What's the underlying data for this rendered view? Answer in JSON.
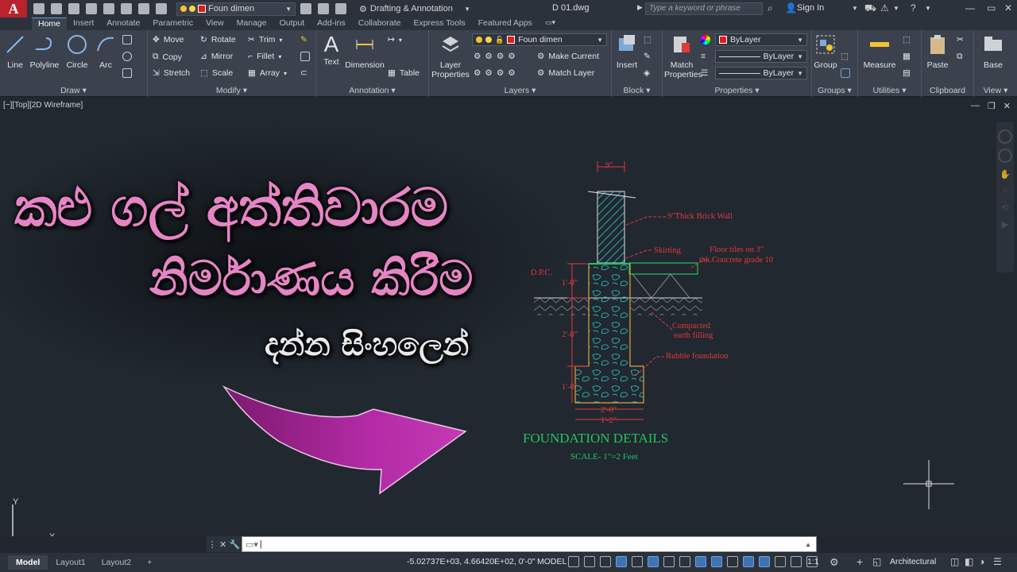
{
  "titlebar": {
    "app_logo": "A",
    "layer_name": "Foun  dimen",
    "workspace": "Drafting & Annotation",
    "document": "D  01.dwg",
    "search_placeholder": "Type a keyword or phrase",
    "signin": "Sign In"
  },
  "ribbon_tabs": [
    "Home",
    "Insert",
    "Annotate",
    "Parametric",
    "View",
    "Manage",
    "Output",
    "Add-ins",
    "Collaborate",
    "Express Tools",
    "Featured Apps"
  ],
  "ribbon": {
    "draw": {
      "title": "Draw",
      "line": "Line",
      "polyline": "Polyline",
      "circle": "Circle",
      "arc": "Arc"
    },
    "modify": {
      "title": "Modify",
      "move": "Move",
      "rotate": "Rotate",
      "trim": "Trim",
      "copy": "Copy",
      "mirror": "Mirror",
      "fillet": "Fillet",
      "stretch": "Stretch",
      "scale": "Scale",
      "array": "Array"
    },
    "annotation": {
      "title": "Annotation",
      "text": "Text",
      "dimension": "Dimension",
      "table": "Table"
    },
    "layers": {
      "title": "Layers",
      "layer_properties_1": "Layer",
      "layer_properties_2": "Properties",
      "layer_combo": "Foun  dimen",
      "make_current": "Make Current",
      "match_layer": "Match Layer"
    },
    "block": {
      "title": "Block",
      "insert": "Insert"
    },
    "properties": {
      "title": "Properties",
      "match_1": "Match",
      "match_2": "Properties",
      "color": "ByLayer",
      "linetype": "ByLayer",
      "lineweight": "ByLayer"
    },
    "groups": {
      "title": "Groups",
      "group": "Group"
    },
    "utilities": {
      "title": "Utilities",
      "measure": "Measure"
    },
    "clipboard": {
      "title": "Clipboard",
      "paste": "Paste"
    },
    "view": {
      "title": "View",
      "base": "Base"
    }
  },
  "viewport": {
    "label": "[−][Top][2D Wireframe]",
    "title_line1": "කළු ගල් අත්තිවාරම",
    "title_line2": "නිර්මාණය කිරීම",
    "title_line3": "දන්න සිංහලෙන්",
    "drawing": {
      "dim_top": "9\"",
      "brick_wall": "9\"Thick Brick Wall",
      "skirting": "Skirting",
      "floor_tiles_1": "Floor tiles on 3\"",
      "floor_tiles_2": "thk.Concrete grade 10",
      "dpc": "D.P.C.",
      "dim_1": "1'-0\"",
      "dim_2": "2'-0\"",
      "dim_3": "1'-0\"",
      "compacted_1": "Compacted",
      "compacted_2": "earth  filling",
      "rubble": "Rubble foundation",
      "dim_bottom_1": "2'-0\"",
      "dim_bottom_2": "1'-2\"",
      "title": "FOUNDATION  DETAILS",
      "scale": "SCALE- 1\"=2 Feet"
    },
    "ucs_x": "X",
    "ucs_y": "Y"
  },
  "statusbar": {
    "tabs": [
      "Model",
      "Layout1",
      "Layout2"
    ],
    "coords": "-5.02737E+03, 4.66420E+02, 0'-0\"",
    "model": "MODEL",
    "annot_scale": "1:1",
    "units": "Architectural"
  }
}
